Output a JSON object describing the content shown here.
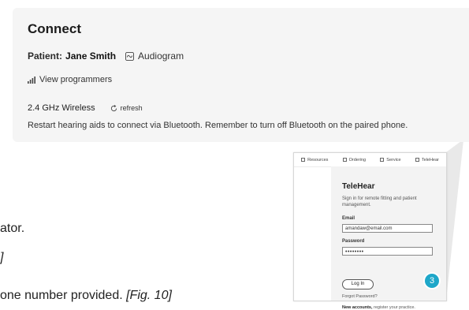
{
  "connect": {
    "title": "Connect",
    "patient_label": "Patient:",
    "patient_name": "Jane Smith",
    "audiogram_label": "Audiogram",
    "view_programmers_label": "View programmers",
    "wireless_label": "2.4 GHz Wireless",
    "refresh_label": "refresh",
    "restart_text": "Restart hearing aids to connect via Bluetooth. Remember to turn off Bluetooth on the paired phone."
  },
  "background_text": {
    "line1": "ator.",
    "line2": "]",
    "line3_prefix": "one number provided. ",
    "line3_ref": "[Fig. 10]"
  },
  "telehear": {
    "nav": [
      {
        "label": "Resources",
        "icon": "external-link-icon"
      },
      {
        "label": "Ordering",
        "icon": "external-link-icon"
      },
      {
        "label": "Service",
        "icon": "external-link-icon"
      },
      {
        "label": "TeleHear",
        "icon": "external-link-icon"
      }
    ],
    "title": "TeleHear",
    "subtitle": "Sign in for remote fitting and patient management.",
    "email_label": "Email",
    "email_value": "amandaw@email.com",
    "password_label": "Password",
    "password_value": "••••••••",
    "login_label": "Log In",
    "step_number": "3",
    "forgot_label": "Forgot Password?",
    "new_accounts_bold": "New accounts,",
    "new_accounts_rest": " register your practice."
  },
  "colors": {
    "card_bg": "#f5f5f5",
    "badge": "#1ea7c9",
    "callout": "#e6e6e6"
  }
}
